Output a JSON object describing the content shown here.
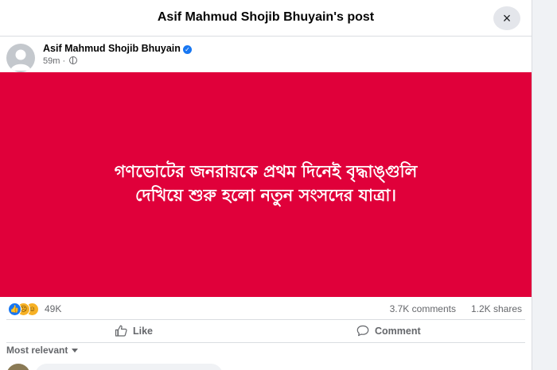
{
  "modal": {
    "title": "Asif Mahmud Shojib Bhuyain's post",
    "close_icon": "×"
  },
  "post": {
    "author": "Asif Mahmud Shojib Bhuyain",
    "verified": true,
    "time": "59m",
    "separator": "·",
    "visibility_icon": "globe-icon",
    "image_text_line1": "গণভোটের জনরায়কে প্রথম দিনেই বৃদ্ধাঙ্গুলি",
    "image_text_line2": "দেখিয়ে শুরু হলো নতুন সংসদের যাত্রা।",
    "image_bg_color": "#e0003a"
  },
  "stats": {
    "reactions": [
      "like",
      "sad",
      "haha"
    ],
    "reaction_count": "49K",
    "comments": "3.7K comments",
    "shares": "1.2K shares"
  },
  "actions": {
    "like": "Like",
    "comment": "Comment"
  },
  "comments": {
    "sort_label": "Most relevant"
  },
  "colors": {
    "accent": "#1877f2",
    "secondary_text": "#65676b"
  }
}
